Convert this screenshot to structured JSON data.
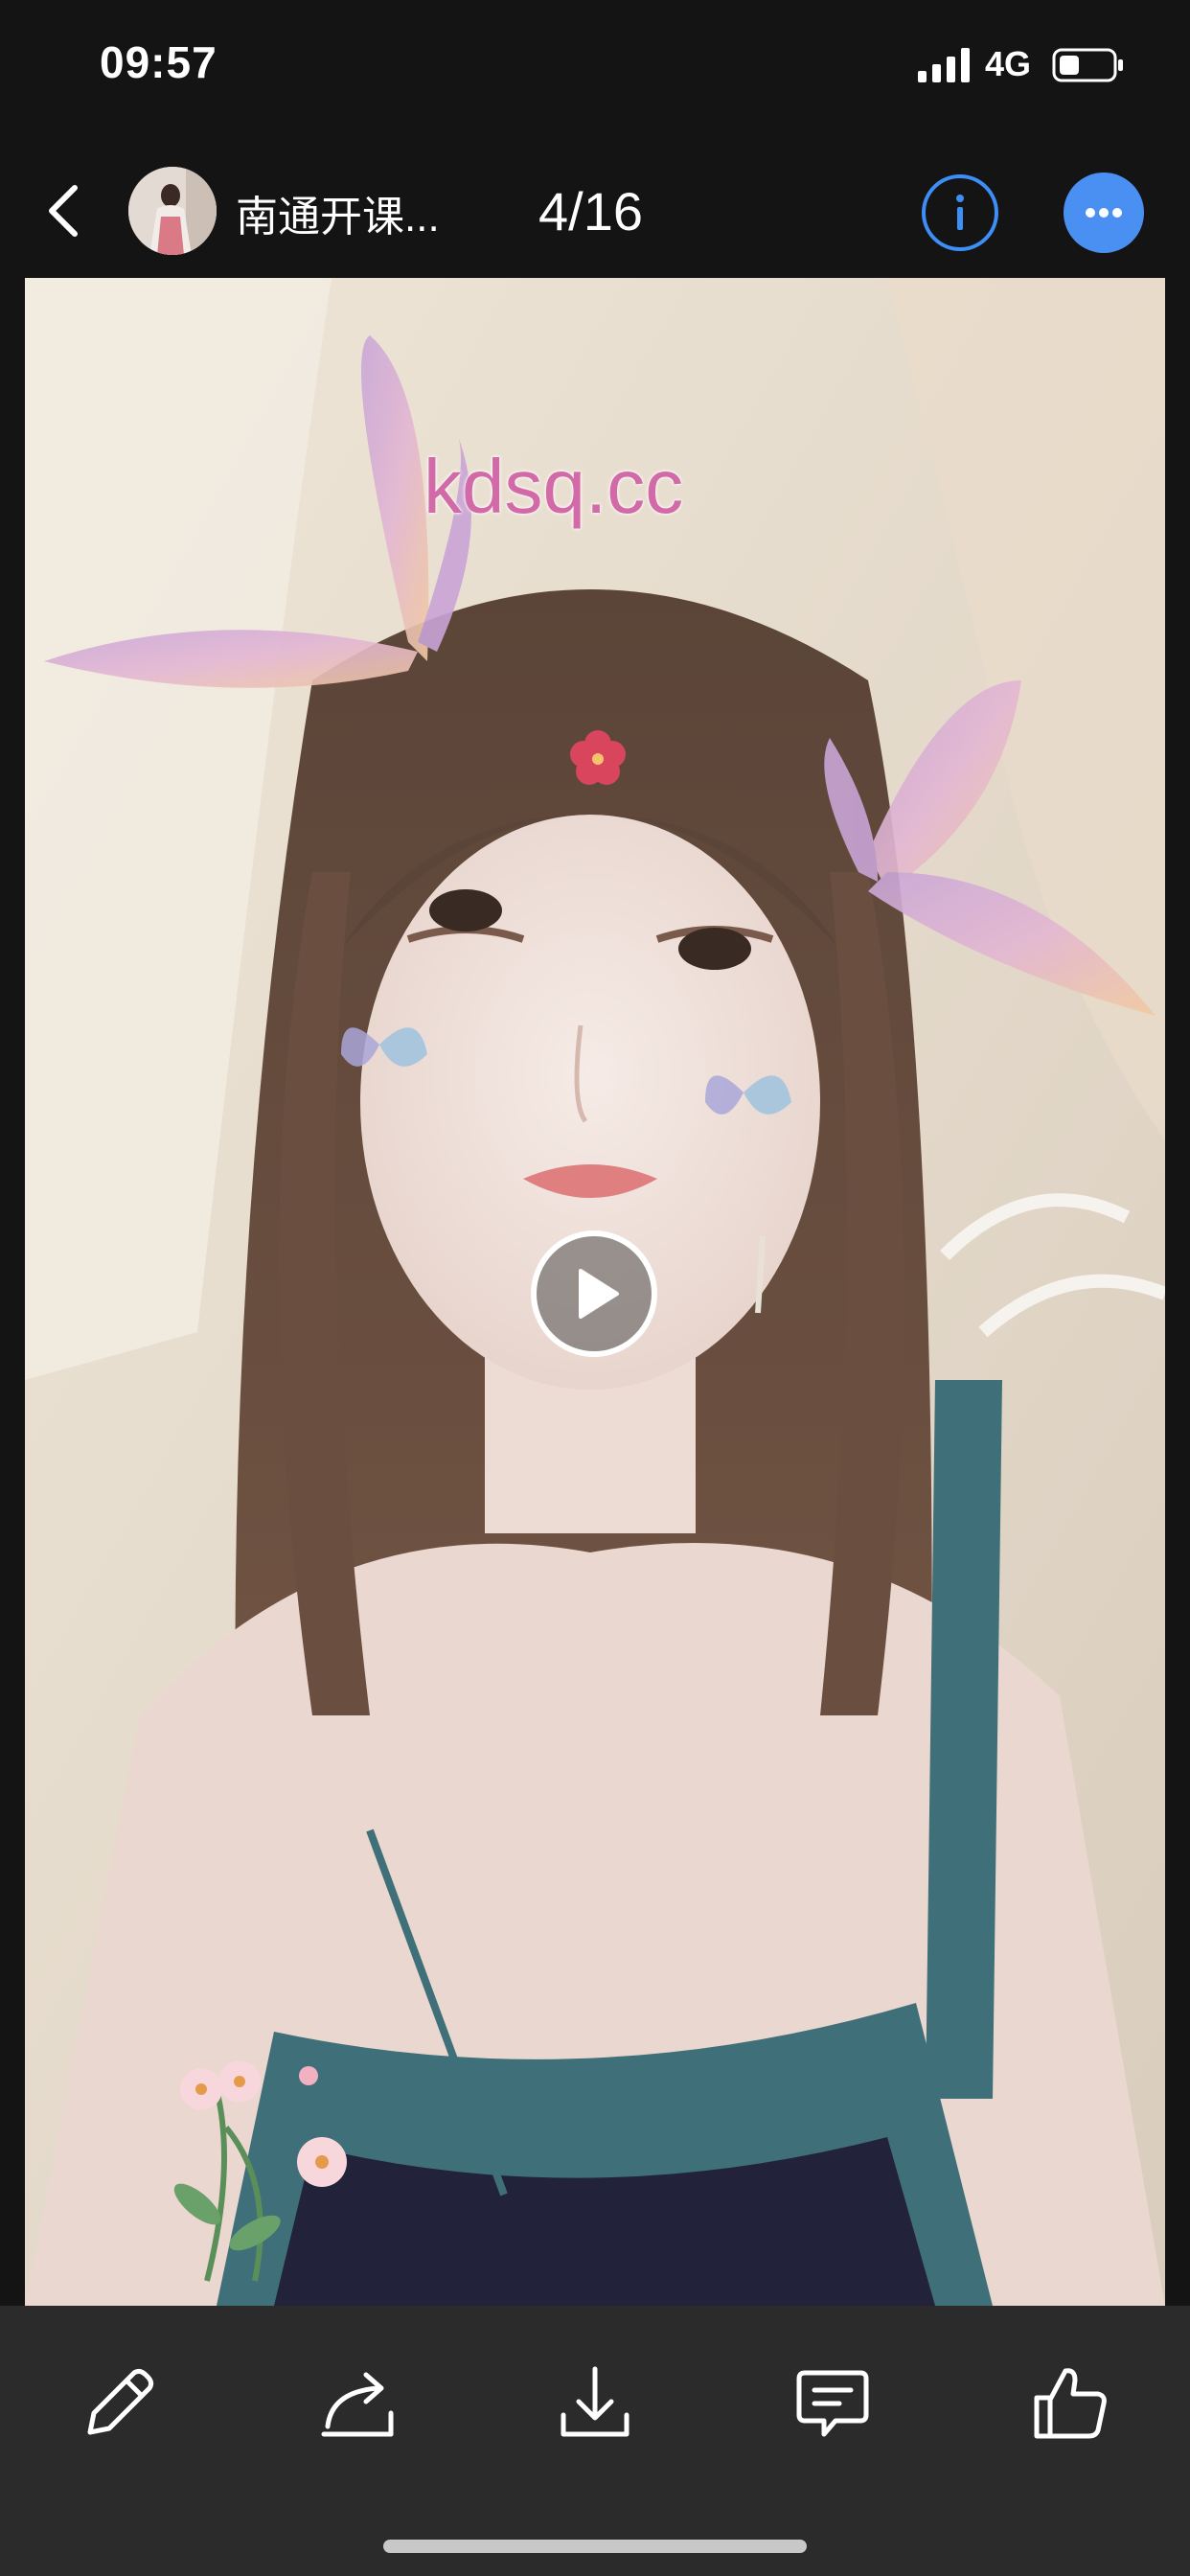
{
  "status_bar": {
    "time": "09:57",
    "network": "4G",
    "icons": [
      "cellular-signal-icon",
      "battery-icon"
    ]
  },
  "nav": {
    "back_icon": "chevron-left-icon",
    "chat_title": "南通开课...",
    "page_counter": "4/16",
    "info_icon": "info-icon",
    "more_icon": "more-dots-icon",
    "accent_color": "#3d8ff5"
  },
  "media": {
    "watermark": "kdsq.cc",
    "type": "video",
    "play_icon": "play-icon"
  },
  "toolbar": {
    "items": [
      {
        "icon": "edit-pencil-icon"
      },
      {
        "icon": "share-forward-icon"
      },
      {
        "icon": "download-icon"
      },
      {
        "icon": "comment-icon"
      },
      {
        "icon": "thumbs-up-icon"
      }
    ]
  }
}
